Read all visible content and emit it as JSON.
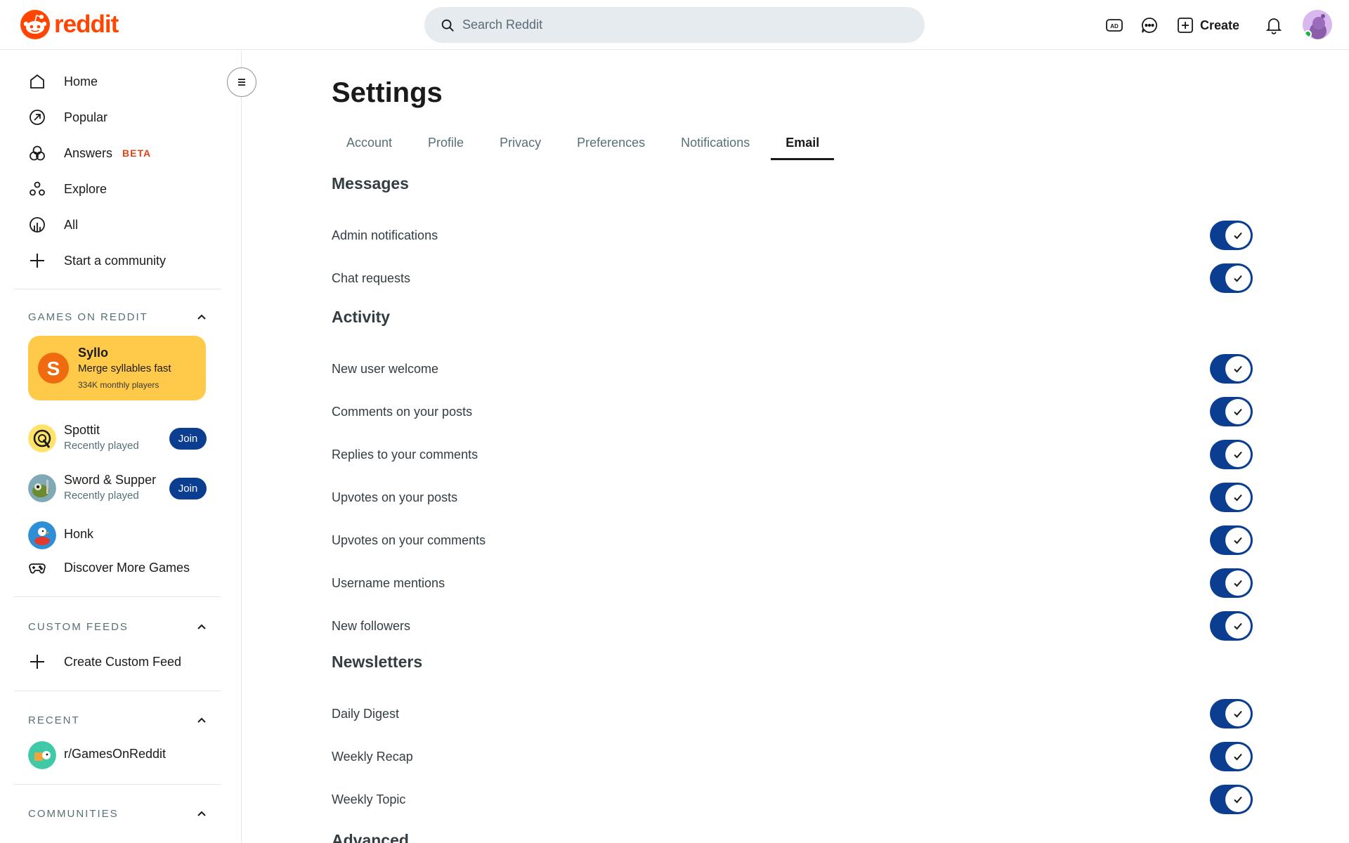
{
  "header": {
    "logo_text": "reddit",
    "search_placeholder": "Search Reddit",
    "icons": [
      "advertise-icon",
      "chat-icon",
      "bell-icon"
    ],
    "create_label": "Create",
    "accent_color": "#ff4500"
  },
  "sidebar": {
    "nav": [
      {
        "label": "Home",
        "icon": "home-icon"
      },
      {
        "label": "Popular",
        "icon": "popular-icon"
      },
      {
        "label": "Answers",
        "icon": "answers-icon",
        "badge": "BETA"
      },
      {
        "label": "Explore",
        "icon": "explore-icon"
      },
      {
        "label": "All",
        "icon": "all-icon"
      },
      {
        "label": "Start a community",
        "icon": "plus-icon"
      }
    ],
    "games_section": {
      "title": "GAMES ON REDDIT",
      "featured": {
        "title": "Syllo",
        "subtitle": "Merge syllables fast",
        "players": "334K monthly players",
        "badge_letter": "S"
      },
      "games": [
        {
          "name": "Spottit",
          "sub": "Recently played",
          "join_label": "Join"
        },
        {
          "name": "Sword & Supper",
          "sub": "Recently played",
          "join_label": "Join"
        },
        {
          "name": "Honk"
        }
      ],
      "discover_label": "Discover More Games"
    },
    "custom_feeds": {
      "title": "CUSTOM FEEDS",
      "create_label": "Create Custom Feed"
    },
    "recent": {
      "title": "RECENT",
      "items": [
        "r/GamesOnReddit"
      ]
    },
    "communities": {
      "title": "COMMUNITIES"
    }
  },
  "main": {
    "title": "Settings",
    "tabs": [
      "Account",
      "Profile",
      "Privacy",
      "Preferences",
      "Notifications",
      "Email"
    ],
    "active_tab": "Email",
    "sections": [
      {
        "title": "Messages",
        "items": [
          {
            "label": "Admin notifications",
            "enabled": true
          },
          {
            "label": "Chat requests",
            "enabled": true
          }
        ]
      },
      {
        "title": "Activity",
        "items": [
          {
            "label": "New user welcome",
            "enabled": true
          },
          {
            "label": "Comments on your posts",
            "enabled": true
          },
          {
            "label": "Replies to your comments",
            "enabled": true
          },
          {
            "label": "Upvotes on your posts",
            "enabled": true
          },
          {
            "label": "Upvotes on your comments",
            "enabled": true
          },
          {
            "label": "Username mentions",
            "enabled": true
          },
          {
            "label": "New followers",
            "enabled": true
          }
        ]
      },
      {
        "title": "Newsletters",
        "items": [
          {
            "label": "Daily Digest",
            "enabled": true
          },
          {
            "label": "Weekly Recap",
            "enabled": true
          },
          {
            "label": "Weekly Topic",
            "enabled": true
          }
        ]
      },
      {
        "title": "Advanced",
        "items": []
      }
    ],
    "toggle_on_color": "#0b3d91"
  }
}
